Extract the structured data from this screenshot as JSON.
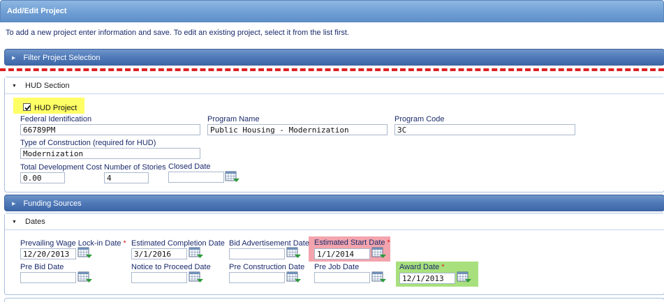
{
  "window": {
    "title": "Add/Edit Project"
  },
  "intro_text": "To add a new project enter information and save. To edit an existing project, select it from the list first.",
  "filter_bar": {
    "label": "Filter Project Selection"
  },
  "hud_section": {
    "title": "HUD Section",
    "hud_project": {
      "label": "HUD Project",
      "checked": true
    },
    "federal_identification": {
      "label": "Federal Identification",
      "value": "66789PM"
    },
    "program_name": {
      "label": "Program Name",
      "value": "Public Housing - Modernization"
    },
    "program_code": {
      "label": "Program Code",
      "value": "3C"
    },
    "type_of_construction": {
      "label": "Type of Construction (required for HUD)",
      "value": "Modernization"
    },
    "total_development_cost": {
      "label": "Total Development Cost",
      "value": "0.00"
    },
    "number_of_stories": {
      "label": "Number of Stories",
      "value": "4"
    },
    "closed_date": {
      "label": "Closed Date",
      "value": ""
    }
  },
  "funding_bar": {
    "label": "Funding Sources"
  },
  "dates_section": {
    "title": "Dates",
    "required_mark": "*",
    "prevailing_wage": {
      "label": "Prevailing Wage Lock-in Date",
      "value": "12/20/2013"
    },
    "estimated_completion": {
      "label": "Estimated Completion Date",
      "value": "3/1/2016"
    },
    "bid_advertisement": {
      "label": "Bid Advertisement Date",
      "value": ""
    },
    "estimated_start": {
      "label": "Estimated Start Date",
      "value": "1/1/2014"
    },
    "pre_bid": {
      "label": "Pre Bid Date",
      "value": ""
    },
    "notice_to_proceed": {
      "label": "Notice to Proceed Date",
      "value": ""
    },
    "pre_construction": {
      "label": "Pre Construction Date",
      "value": ""
    },
    "pre_job": {
      "label": "Pre Job Date",
      "value": ""
    },
    "award_date": {
      "label": "Award Date",
      "value": "12/1/2013"
    }
  },
  "icons": {
    "expand": "triangle-right-icon",
    "collapse": "triangle-down-icon",
    "calendar": "calendar-picker-icon"
  },
  "colors": {
    "title_bar": "#6f9fd4",
    "section_bar": "#4f79b8",
    "label_text": "#1a2a6b",
    "highlight_yellow": "#ffff66",
    "highlight_red": "#f3a4ad",
    "highlight_green": "#a8e07d",
    "dashed_line": "#dd2020"
  }
}
